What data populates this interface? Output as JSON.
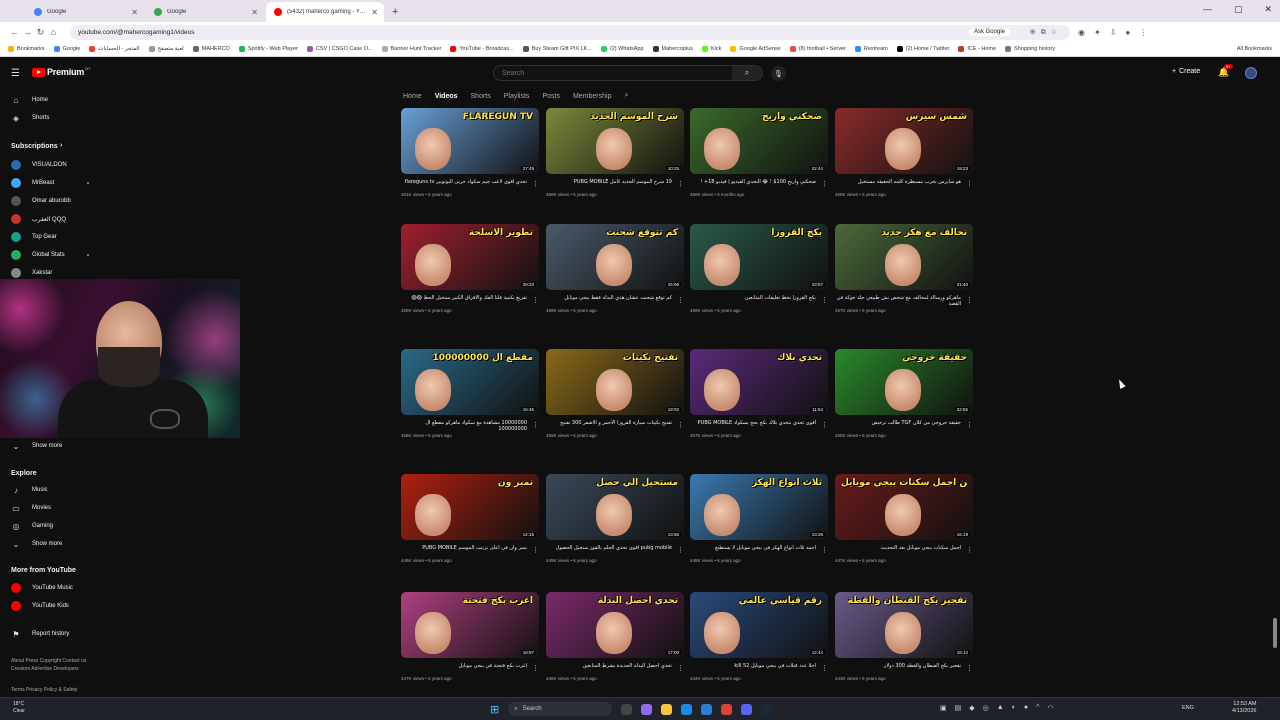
{
  "browser": {
    "tabs": [
      {
        "title": "Google",
        "color": "#4285f4",
        "active": false
      },
      {
        "title": "Google",
        "color": "#34a853",
        "active": false
      },
      {
        "title": "(5432) maherco gaming - YouTube",
        "color": "#ff0000",
        "active": true
      }
    ],
    "url": "youtube.com/@mahercogaming1/videos",
    "ask_google": "Ask Google",
    "bookmarks": [
      {
        "label": "Bookmarks",
        "color": "#f4b400"
      },
      {
        "label": "Google",
        "color": "#4285f4"
      },
      {
        "label": "المتجر - الحسابات",
        "color": "#ea4335"
      },
      {
        "label": "لعبة متصفح",
        "color": "#999999"
      },
      {
        "label": "MAHERCO",
        "color": "#666666"
      },
      {
        "label": "Spotify - Web Player",
        "color": "#1db954"
      },
      {
        "label": "CSV | CSGO Case O...",
        "color": "#9b59b6"
      },
      {
        "label": "Banner Hunt Tracker",
        "color": "#aaaaaa"
      },
      {
        "label": "YouTube - Broadcas...",
        "color": "#ff0000"
      },
      {
        "label": "Buy Steam Gift PIX LK...",
        "color": "#555555"
      },
      {
        "label": "(2) WhatsApp",
        "color": "#25d366"
      },
      {
        "label": "Mahercoplus",
        "color": "#333333"
      },
      {
        "label": "Kick",
        "color": "#53fc18"
      },
      {
        "label": "Google AdSense",
        "color": "#fbbc04"
      },
      {
        "label": "(8) football • Server",
        "color": "#e74c3c"
      },
      {
        "label": "Restream",
        "color": "#2d8cff"
      },
      {
        "label": "(2) Home / Twitter",
        "color": "#000000"
      },
      {
        "label": "ICE - Home",
        "color": "#c0392b"
      },
      {
        "label": "Shopping history",
        "color": "#777777"
      }
    ],
    "all_bookmarks": "All Bookmarks"
  },
  "youtube": {
    "brand": "Premium",
    "brand_sup": "MT",
    "search_placeholder": "Search",
    "create_label": "Create",
    "notif_count": "9+",
    "channel_tabs": [
      "Home",
      "Videos",
      "Shorts",
      "Playlists",
      "Posts",
      "Membership"
    ],
    "active_tab": "Videos"
  },
  "sidebar": {
    "main": [
      {
        "label": "Home",
        "icon": "home-icon"
      },
      {
        "label": "Shorts",
        "icon": "shorts-icon"
      }
    ],
    "subscriptions_header": "Subscriptions",
    "subscriptions": [
      {
        "label": "VISUALDON",
        "color": "#2b6cb0",
        "dot": false
      },
      {
        "label": "MrBeast",
        "color": "#3fa9f5",
        "dot": true
      },
      {
        "label": "Omar aburobb",
        "color": "#555555",
        "dot": false
      },
      {
        "label": "العقرب QQQ",
        "color": "#c0392b",
        "dot": false
      },
      {
        "label": "Top Gear",
        "color": "#16a085",
        "dot": false
      },
      {
        "label": "Global Stats",
        "color": "#27ae60",
        "dot": true
      },
      {
        "label": "Xakstar",
        "color": "#888888",
        "dot": false
      }
    ],
    "show_more_1": "Show more",
    "explore_header": "Explore",
    "explore": [
      {
        "label": "Music",
        "icon": "music-icon"
      },
      {
        "label": "Movies",
        "icon": "movies-icon"
      },
      {
        "label": "Gaming",
        "icon": "gaming-icon"
      }
    ],
    "show_more_2": "Show more",
    "more_header": "More from YouTube",
    "more": [
      {
        "label": "YouTube Music",
        "color": "#ff0000"
      },
      {
        "label": "YouTube Kids",
        "color": "#ff0000"
      }
    ],
    "report_history": "Report history",
    "footer_1": "About  Press  Copyright  Contact us  Creators  Advertise  Developers",
    "footer_2": "Terms  Privacy  Policy & Safety"
  },
  "videos": [
    {
      "title": "تحدي اقوى لاعب جيم سكواد حربي البوتوبير flareguns tv",
      "views": "461K views",
      "age": "6 years ago",
      "duration": "27:49",
      "thumb_text": "FLAREGUN TV",
      "bg": "#6aa0d8"
    },
    {
      "title": "19 شرح الموسم الجديد كامل PUBG MOBILE",
      "views": "460K views",
      "age": "6 years ago",
      "duration": "10:25",
      "thumb_text": "شرح الموسم الجديد",
      "bg": "#7a8a3a"
    },
    {
      "title": "ضحكتي واربح 100$ ! 😂 التحدي الفيديو | فيديو 18+ !",
      "views": "460K views",
      "age": "9 months ago",
      "duration": "22:44",
      "thumb_text": "ضحكني واربح",
      "bg": "#3a6a2a"
    },
    {
      "title": "هو سايرس بحرب مسيطرة كلمة الحقيقة مستحيل",
      "views": "460K views",
      "age": "6 years ago",
      "duration": "19:23",
      "thumb_text": "شمس سيرس",
      "bg": "#8a2a2a"
    },
    {
      "title": "تفريغ بكمية فلتا الفك والافراق الكبير ستحيل الحظ 😱😱",
      "views": "459K views",
      "age": "6 years ago",
      "duration": "28:33",
      "thumb_text": "تطوير الاسلحة",
      "bg": "#a02030"
    },
    {
      "title": "كم توقع شحنت عشان هذي البدلة فقط ببجي موبايل",
      "views": "459K views",
      "age": "6 years ago",
      "duration": "15:06",
      "thumb_text": "كم تتوقع شحنت",
      "bg": "#4a5a6a"
    },
    {
      "title": "بكج القروزا بحظ تعليقات المتابعين",
      "views": "458K views",
      "age": "6 years ago",
      "duration": "23:57",
      "thumb_text": "بكج القروزا",
      "bg": "#2a5a4a"
    },
    {
      "title": "ماهركو ورسالة لمحالف مع شخص بش طبيعي جلد جوكة في القصة",
      "views": "457K views",
      "age": "6 years ago",
      "duration": "21:40",
      "thumb_text": "تحالف مع هكر جديد",
      "bg": "#4a6a3a"
    },
    {
      "title": "10000000 مشاهدة مع سكواد ماهركو مقطع ال 100000000",
      "views": "456K views",
      "age": "6 years ago",
      "duration": "16:45",
      "thumb_text": "مقطع ال 100000000",
      "bg": "#2a6a8a"
    },
    {
      "title": "تفتيح بكيتات سيارة القروزا الاحمر و الاصفر 300 تفتيح",
      "views": "455K views",
      "age": "6 years ago",
      "duration": "19:02",
      "thumb_text": "تفتيح بكيتات",
      "bg": "#8a6a1a"
    },
    {
      "title": "اقوى تحدي بتحدي بلاك بكج بحج بسكواد PUBG MOBILE",
      "views": "457K views",
      "age": "6 years ago",
      "duration": "11:54",
      "thumb_text": "تحدي بلاك",
      "bg": "#5a2a7a"
    },
    {
      "title": "حقيقة خروجي من كلان TGF طالب ترخيص",
      "views": "450K views",
      "age": "6 years ago",
      "duration": "32:55",
      "thumb_text": "حقيقة خروجي",
      "bg": "#2a8a2a"
    },
    {
      "title": "نمبر وان في اعلى ترتيب الموسم PUBG MOBILE",
      "views": "449K views",
      "age": "6 years ago",
      "duration": "12:15",
      "thumb_text": "نمبر ون",
      "bg": "#b02010"
    },
    {
      "title": "pubg mobile اقوى تحدي الحلم بالفوز ستحيل الحصول",
      "views": "449K views",
      "age": "6 years ago",
      "duration": "13:55",
      "thumb_text": "مستحيل الي حصل",
      "bg": "#3a4a5a"
    },
    {
      "title": "احمد ثلاث انواع الهكر في ببجي موبايل لا يستطيع",
      "views": "448K views",
      "age": "6 years ago",
      "duration": "13:26",
      "thumb_text": "ثلاث انواع الهكر",
      "bg": "#3a7ab0"
    },
    {
      "title": "اجمل سكنات ببجي موبايل بعد التحديث",
      "views": "447K views",
      "age": "6 years ago",
      "duration": "16:19",
      "thumb_text": "من اجمل سكنات ببجي موبايل",
      "bg": "#6a1a1a"
    },
    {
      "title": "اغرب بكج فتحتة في ببجي موبايل",
      "views": "447K views",
      "age": "5 years ago",
      "duration": "16:57",
      "thumb_text": "اغرب بكج فتحتة",
      "bg": "#b04080"
    },
    {
      "title": "تحدي احصل البدلة الجديدة بشرط المتابعين",
      "views": "446K views",
      "age": "5 years ago",
      "duration": "17:00",
      "thumb_text": "تحدي احصل البدلة",
      "bg": "#7a2a6a"
    },
    {
      "title": "احلا عدد قتلات في ببجي موبايل 52 kill",
      "views": "444K views",
      "age": "6 years ago",
      "duration": "12:44",
      "thumb_text": "رقم قياسي عالمي",
      "bg": "#2a4a7a"
    },
    {
      "title": "تفجير بكج القبطان والقطة 300 دولار",
      "views": "443K views",
      "age": "5 years ago",
      "duration": "16:14",
      "thumb_text": "تفجير بكج القبطان والقطة",
      "bg": "#6a5a8a"
    }
  ],
  "taskbar": {
    "weather_temp": "18°C",
    "weather_desc": "Clear",
    "search_label": "Search",
    "lang": "ENG",
    "time": "12:53 AM",
    "date": "4/13/2026"
  }
}
